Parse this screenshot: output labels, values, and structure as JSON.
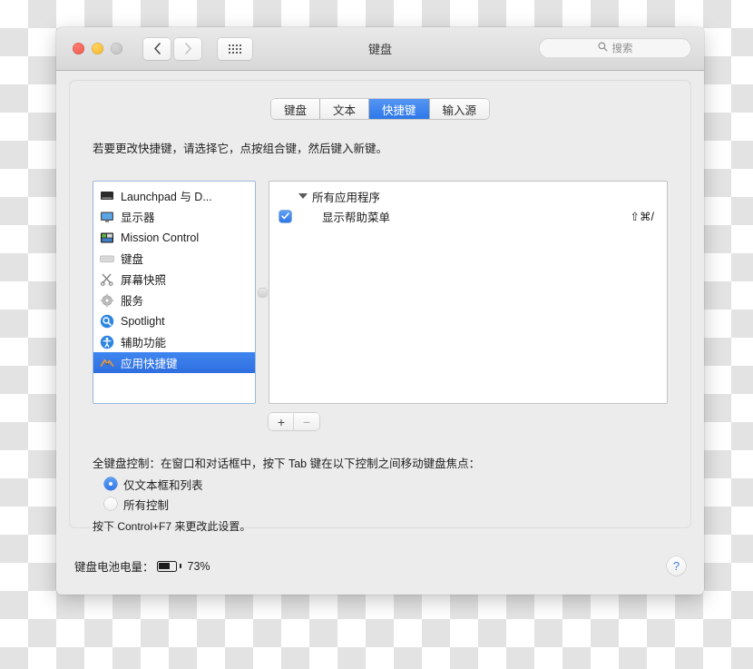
{
  "window": {
    "title": "键盘",
    "traffic_lights": [
      "close",
      "minimize",
      "zoom"
    ],
    "search": {
      "placeholder": "搜索",
      "value": "",
      "icon": "search-icon"
    },
    "nav": {
      "back": "back-icon",
      "forward": "forward-icon",
      "grid": "show-all-icon"
    }
  },
  "tabs": [
    {
      "label": "键盘",
      "active": false
    },
    {
      "label": "文本",
      "active": false
    },
    {
      "label": "快捷键",
      "active": true
    },
    {
      "label": "输入源",
      "active": false
    }
  ],
  "instruction": "若要更改快捷键，请选择它，点按组合键，然后键入新键。",
  "sidebar": {
    "items": [
      {
        "label": "Launchpad 与 D...",
        "icon": "launchpad-dock-icon",
        "selected": false
      },
      {
        "label": "显示器",
        "icon": "display-icon",
        "selected": false
      },
      {
        "label": "Mission Control",
        "icon": "mission-control-icon",
        "selected": false
      },
      {
        "label": "键盘",
        "icon": "keyboard-icon",
        "selected": false
      },
      {
        "label": "屏幕快照",
        "icon": "screenshot-icon",
        "selected": false
      },
      {
        "label": "服务",
        "icon": "services-gear-icon",
        "selected": false
      },
      {
        "label": "Spotlight",
        "icon": "spotlight-icon",
        "selected": false
      },
      {
        "label": "辅助功能",
        "icon": "accessibility-icon",
        "selected": false
      },
      {
        "label": "应用快捷键",
        "icon": "app-shortcuts-icon",
        "selected": true
      }
    ]
  },
  "shortcut_list": {
    "group": {
      "label": "所有应用程序",
      "expanded": true
    },
    "items": [
      {
        "label": "显示帮助菜单",
        "shortcut": "⇧⌘/",
        "checked": true
      }
    ]
  },
  "list_buttons": {
    "add": "+",
    "remove": "−"
  },
  "full_keyboard_access": {
    "title": "全键盘控制：在窗口和对话框中，按下 Tab 键在以下控制之间移动键盘焦点：",
    "options": [
      {
        "label": "仅文本框和列表",
        "selected": true
      },
      {
        "label": "所有控制",
        "selected": false
      }
    ],
    "hint": "按下 Control+F7 来更改此设置。"
  },
  "footer": {
    "battery_label": "键盘电池电量：",
    "battery_percent": "73%",
    "battery_level": 73,
    "help_label": "?"
  },
  "colors": {
    "accent_blue": "#2f78e9",
    "selection_blue": "#3f86ef",
    "window_bg": "#ececec",
    "pane_bg": "#ffffff"
  }
}
